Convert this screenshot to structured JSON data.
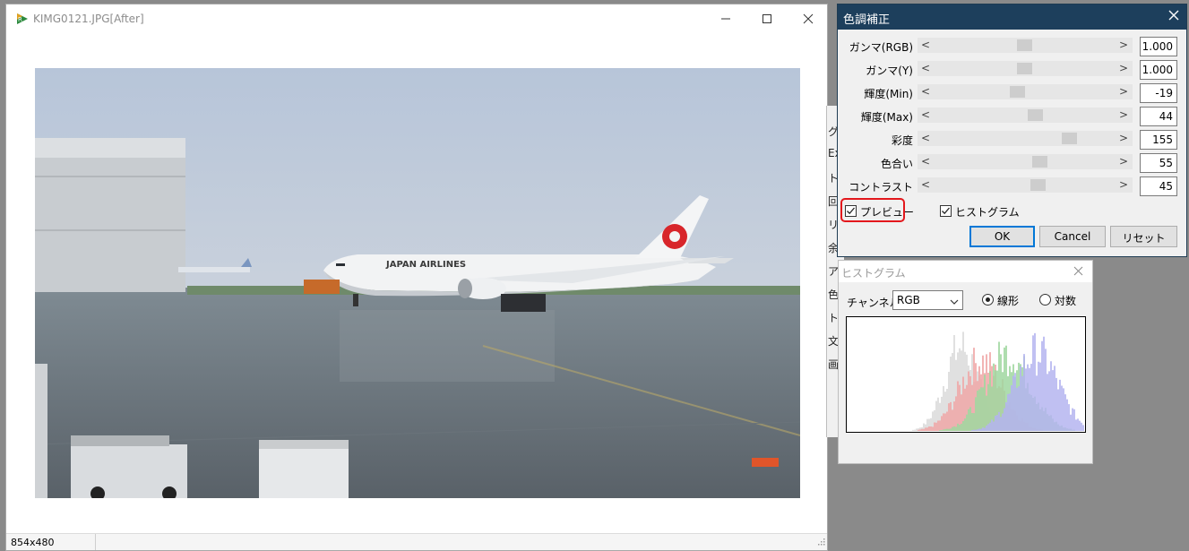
{
  "main_window": {
    "title": "KIMG0121.JPG[After]",
    "status_size": "854x480"
  },
  "background_panel": {
    "fragments": [
      "グ",
      "Ex",
      "ト",
      "回",
      "リ",
      "余",
      "ア",
      "色",
      "ト",
      "文",
      "画"
    ]
  },
  "color_dialog": {
    "title": "色調補正",
    "rows": [
      {
        "label": "ガンマ(RGB)",
        "value": "1.000",
        "level": 0.5
      },
      {
        "label": "ガンマ(Y)",
        "value": "1.000",
        "level": 0.5
      },
      {
        "label": "輝度(Min)",
        "value": "-19",
        "level": 0.46
      },
      {
        "label": "輝度(Max)",
        "value": "44",
        "level": 0.56
      },
      {
        "label": "彩度",
        "value": "155",
        "level": 0.74
      },
      {
        "label": "色合い",
        "value": "55",
        "level": 0.58
      },
      {
        "label": "コントラスト",
        "value": "45",
        "level": 0.57
      }
    ],
    "preview_label": "プレビュー",
    "preview_checked": true,
    "histogram_label": "ヒストグラム",
    "histogram_checked": true,
    "ok_label": "OK",
    "cancel_label": "Cancel",
    "reset_label": "リセット"
  },
  "histogram_dialog": {
    "title": "ヒストグラム",
    "channel_label": "チャンネル",
    "channel_value": "RGB",
    "linear_label": "線形",
    "log_label": "対数",
    "selected_mode": "linear"
  },
  "colors": {
    "dialog_title_bg": "#1d3f5c",
    "highlight": "#e3171c",
    "ok_border": "#0078d7",
    "hist_gray": "#b8b8b8",
    "hist_red": "#e05050",
    "hist_green": "#40b040",
    "hist_blue": "#6a6ae0"
  }
}
